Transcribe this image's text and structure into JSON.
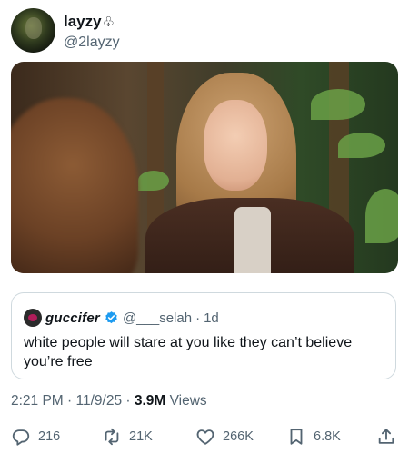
{
  "post": {
    "author": {
      "display_name": "layzy",
      "name_symbol": "♧",
      "handle": "@2layzy"
    },
    "quoted": {
      "display_name": "guccifer",
      "handle": "@___selah",
      "separator": "·",
      "time": "1d",
      "text": "white people will stare at you like they can’t believe you’re free"
    },
    "meta": {
      "time_date": "2:21 PM · 11/9/25 · ",
      "views_count": "3.9M",
      "views_label": " Views"
    },
    "actions": {
      "replies": "216",
      "reposts": "21K",
      "likes": "266K",
      "bookmarks": "6.8K"
    }
  },
  "icons": {
    "reply": "reply-icon",
    "repost": "repost-icon",
    "like": "like-icon",
    "bookmark": "bookmark-icon",
    "share": "share-icon",
    "verified": "verified-badge-icon"
  },
  "colors": {
    "text": "#0f1419",
    "secondary": "#536471",
    "border": "#cfd9de",
    "verified": "#1d9bf0"
  }
}
